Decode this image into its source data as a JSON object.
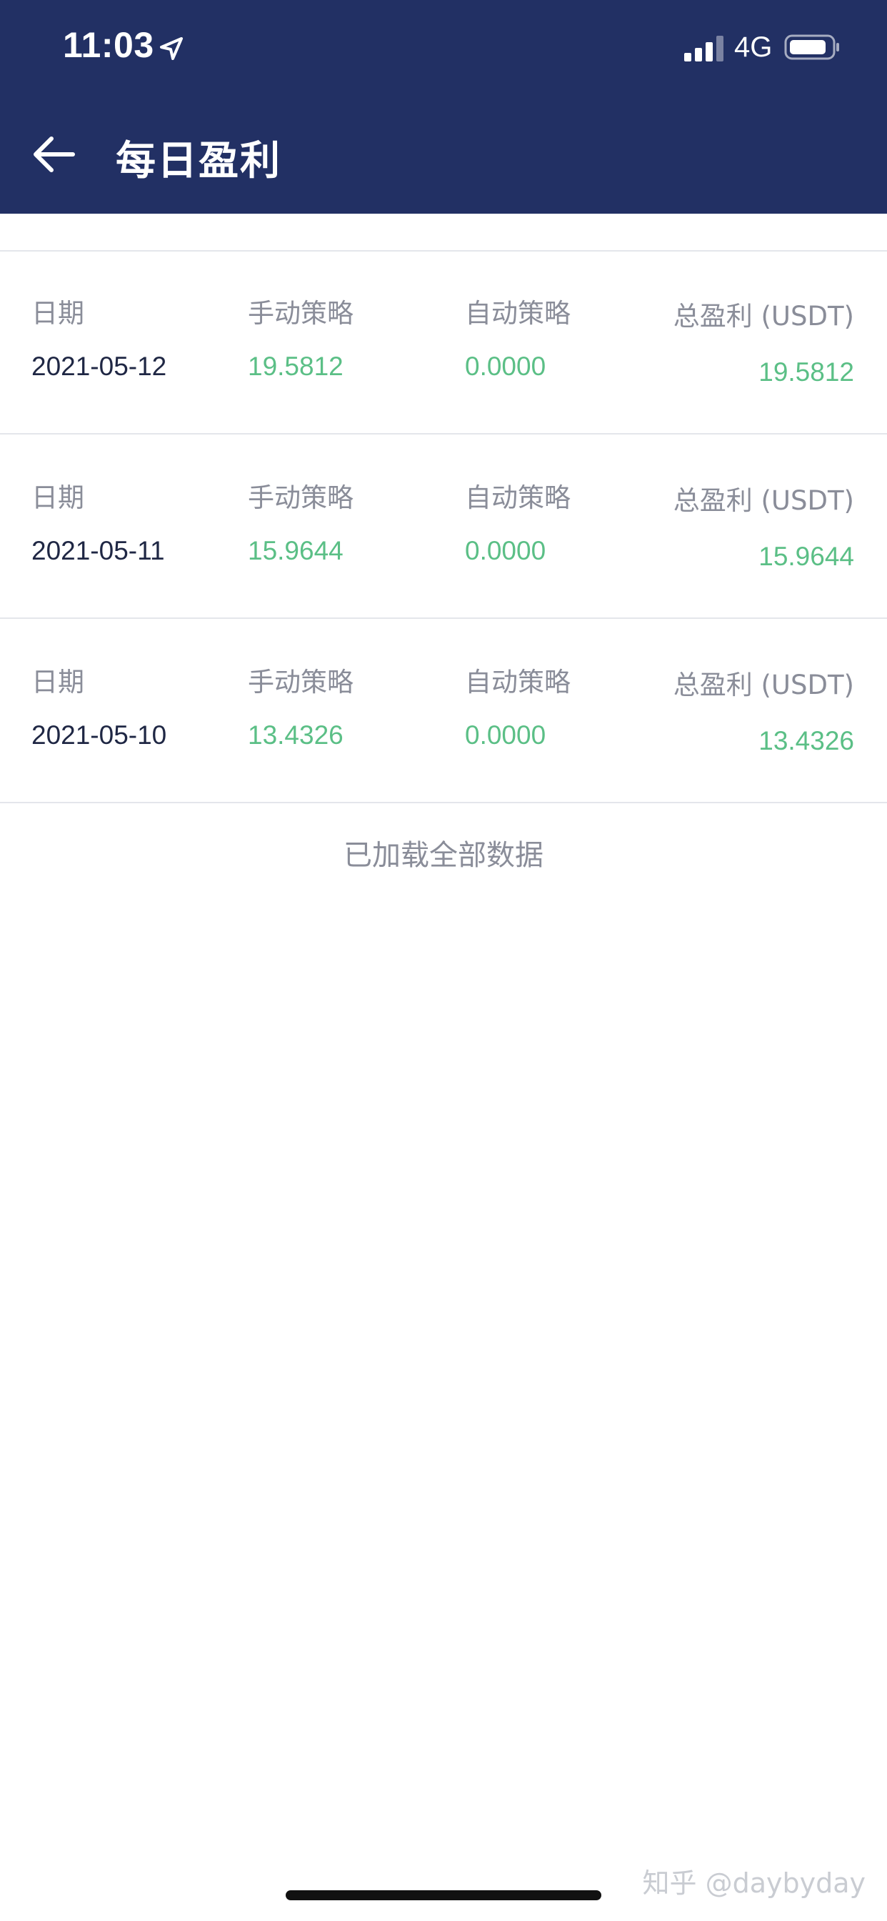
{
  "status_bar": {
    "time": "11:03",
    "network": "4G",
    "icons": [
      "location-arrow-icon",
      "signal-icon",
      "battery-icon"
    ]
  },
  "nav": {
    "back_icon": "back-arrow-icon",
    "title": "每日盈利"
  },
  "columns": {
    "date": "日期",
    "manual": "手动策略",
    "auto": "自动策略",
    "total": "总盈利 (USDT)"
  },
  "records": [
    {
      "date": "2021-05-12",
      "manual": "19.5812",
      "auto": "0.0000",
      "total": "19.5812"
    },
    {
      "date": "2021-05-11",
      "manual": "15.9644",
      "auto": "0.0000",
      "total": "15.9644"
    },
    {
      "date": "2021-05-10",
      "manual": "13.4326",
      "auto": "0.0000",
      "total": "13.4326"
    }
  ],
  "footer_note": "已加载全部数据",
  "watermark": "知乎 @daybyday",
  "colors": {
    "header_bg": "#223064",
    "profit_green": "#5bbf86",
    "label_gray": "#8a8d99",
    "divider": "#e4e6eb"
  }
}
